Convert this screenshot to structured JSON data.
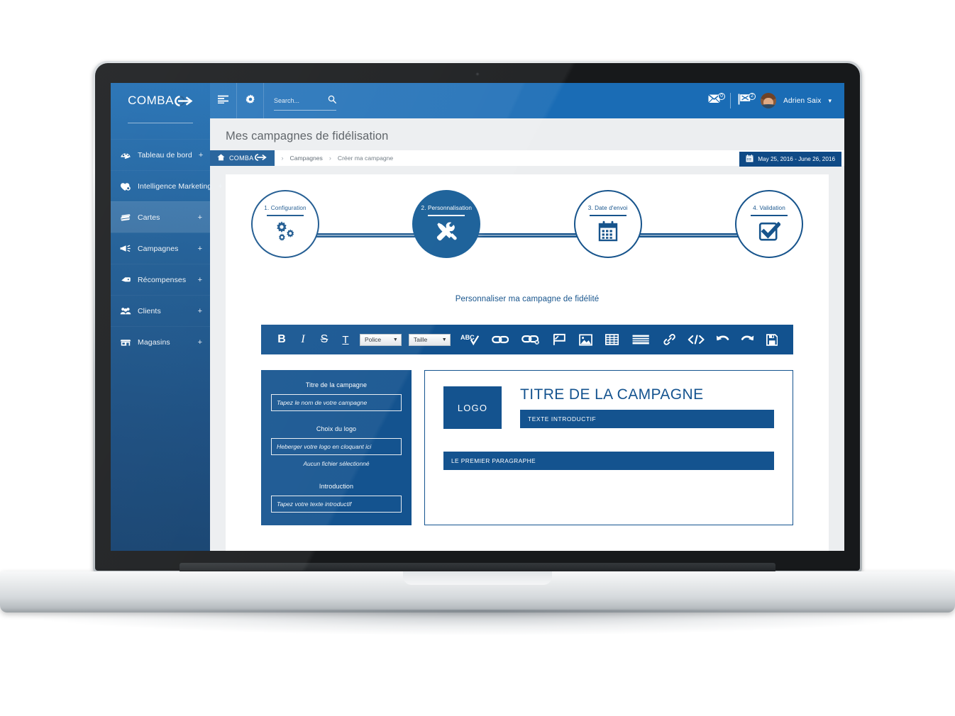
{
  "brand": {
    "logo_text": "COMBA",
    "accent": "#14538f",
    "sidebar_blue": "#15558f",
    "topbar_blue": "#1a6cb5"
  },
  "sidebar": {
    "items": [
      {
        "label": "Tableau de bord",
        "icon": "dashboard-icon",
        "expander": "+",
        "active": false
      },
      {
        "label": "Intelligence Marketing",
        "icon": "heart-bulb-icon",
        "expander": "+",
        "active": false
      },
      {
        "label": "Cartes",
        "icon": "cards-icon",
        "expander": "+",
        "active": true
      },
      {
        "label": "Campagnes",
        "icon": "megaphone-icon",
        "expander": "+",
        "active": false
      },
      {
        "label": "Récompenses",
        "icon": "tag-icon",
        "expander": "+",
        "active": false
      },
      {
        "label": "Clients",
        "icon": "users-icon",
        "expander": "+",
        "active": false
      },
      {
        "label": "Magasins",
        "icon": "store-icon",
        "expander": "+",
        "active": false
      }
    ]
  },
  "topbar": {
    "menu_icon": "list-menu-icon",
    "settings_icon": "gear-icon",
    "search": {
      "placeholder": "Search...",
      "value": "",
      "icon": "search-icon"
    },
    "messages": {
      "icon": "envelope-icon",
      "count": "0"
    },
    "notifications": {
      "icon": "flag-icon",
      "count": "2"
    },
    "user": {
      "name": "Adrien Saix",
      "caret": "⌄",
      "avatar": "user-avatar"
    }
  },
  "page": {
    "title": "Mes campagnes de fidélisation"
  },
  "breadcrumb": {
    "home_icon": "home-icon",
    "home_label": "COMBA",
    "separator": "›",
    "items": [
      {
        "label": "Campagnes",
        "current": false
      },
      {
        "label": "Créer ma campagne",
        "current": true
      }
    ]
  },
  "daterange": {
    "icon": "calendar-icon",
    "value": "May 25, 2016 - June 26, 2016"
  },
  "stepper": {
    "steps": [
      {
        "label": "1. Configuration",
        "icon": "gears-icon",
        "active": false
      },
      {
        "label": "2. Personnalisation",
        "icon": "hammer-wrench-icon",
        "active": true
      },
      {
        "label": "3. Date d'envoi",
        "icon": "calendar-icon",
        "active": false
      },
      {
        "label": "4. Validation",
        "icon": "check-box-icon",
        "active": false
      }
    ]
  },
  "section": {
    "title": "Personnaliser ma campagne de fidélité"
  },
  "toolbar": {
    "bold": "B",
    "italic": "I",
    "strike": "S",
    "underline": "T",
    "font_select": {
      "value": "Police",
      "caret": "▼"
    },
    "size_select": {
      "value": "Taille",
      "caret": "▼"
    },
    "items": [
      {
        "name": "spellcheck-icon",
        "label": "ABC"
      },
      {
        "name": "link-icon",
        "label": ""
      },
      {
        "name": "unlink-icon",
        "label": ""
      },
      {
        "name": "anchor-flag-icon",
        "label": ""
      },
      {
        "name": "image-icon",
        "label": ""
      },
      {
        "name": "table-icon",
        "label": ""
      },
      {
        "name": "align-icon",
        "label": ""
      },
      {
        "name": "chain-link-icon",
        "label": ""
      },
      {
        "name": "source-code-icon",
        "label": "</>"
      },
      {
        "name": "undo-icon",
        "label": ""
      },
      {
        "name": "redo-icon",
        "label": ""
      },
      {
        "name": "save-icon",
        "label": ""
      }
    ]
  },
  "form": {
    "fields": [
      {
        "label": "Titre de la campagne",
        "placeholder": "Tapez le nom de votre campagne",
        "value": "",
        "note": ""
      },
      {
        "label": "Choix du logo",
        "placeholder": "Heberger votre logo en cloquant ici",
        "value": "",
        "note": "Aucun fichier sélectionné"
      },
      {
        "label": "Introduction",
        "placeholder": "Tapez votre texte introductif",
        "value": "",
        "note": ""
      }
    ]
  },
  "preview": {
    "logo_label": "LOGO",
    "title": "TITRE DE LA CAMPAGNE",
    "subtitle": "TEXTE INTRODUCTIF",
    "paragraph": "LE PREMIER PARAGRAPHE"
  }
}
